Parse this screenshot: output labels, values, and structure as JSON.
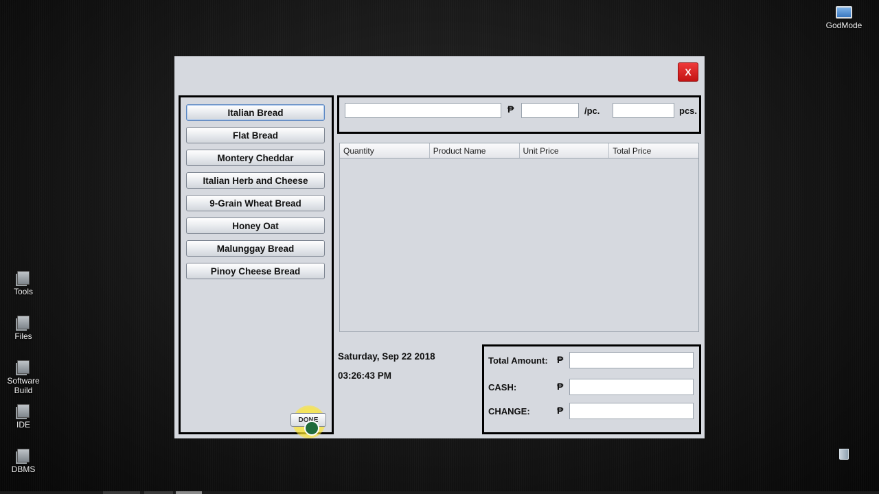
{
  "desktop": {
    "icons": [
      {
        "label": "Tools"
      },
      {
        "label": "Files"
      },
      {
        "label": "Software Build"
      },
      {
        "label": "IDE"
      },
      {
        "label": "DBMS"
      }
    ],
    "top_right_icon": {
      "label": "GodMode"
    }
  },
  "window": {
    "close_label": "X",
    "products": [
      {
        "label": "Italian Bread",
        "selected": true
      },
      {
        "label": "Flat Bread"
      },
      {
        "label": "Montery Cheddar"
      },
      {
        "label": "Italian Herb and Cheese"
      },
      {
        "label": "9-Grain Wheat Bread"
      },
      {
        "label": "Honey Oat"
      },
      {
        "label": "Malunggay Bread"
      },
      {
        "label": "Pinoy Cheese Bread"
      }
    ],
    "done_label": "DONE",
    "entry": {
      "product_value": "",
      "currency_symbol": "₱",
      "price_value": "",
      "per_unit_label": "/pc.",
      "qty_value": "",
      "qty_unit_label": "pcs."
    },
    "table": {
      "columns": [
        "Quantity",
        "Product Name",
        "Unit Price",
        "Total Price"
      ],
      "rows": []
    },
    "date": "Saturday, Sep 22 2018",
    "time": "03:26:43 PM",
    "totals": {
      "total_amount_label": "Total Amount:",
      "cash_label": "CASH:",
      "change_label": "CHANGE:",
      "currency_symbol": "₱",
      "total_amount_value": "",
      "cash_value": "",
      "change_value": ""
    }
  },
  "colors": {
    "window_bg": "#d6d9df",
    "close_button": "#e02424",
    "panel_border": "#000000"
  }
}
